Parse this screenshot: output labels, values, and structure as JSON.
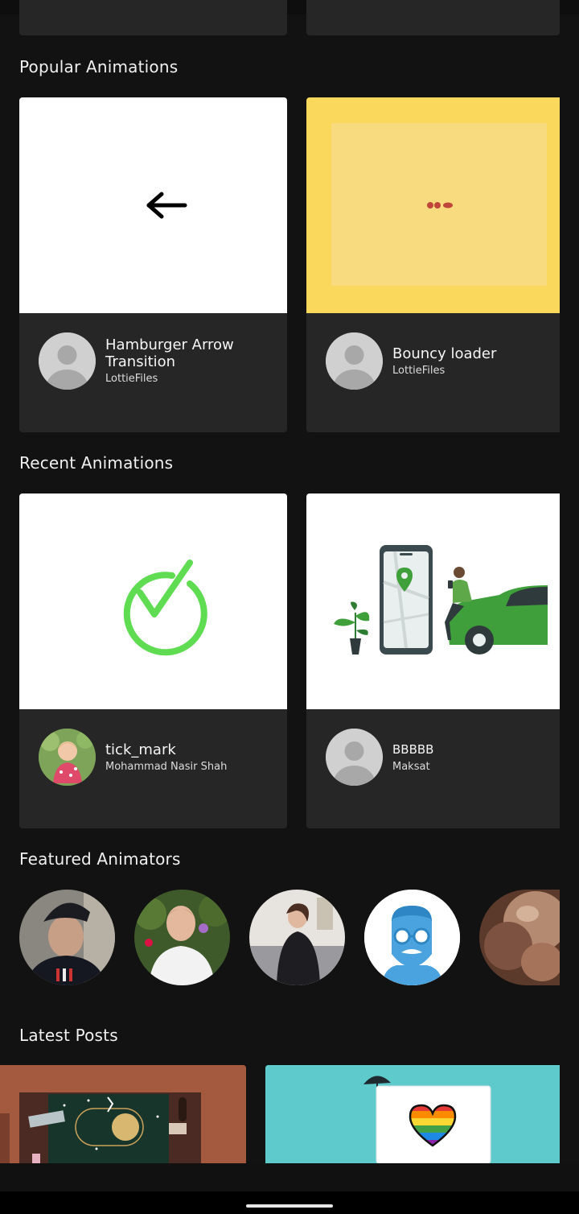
{
  "sections": {
    "popular_title": "Popular Animations",
    "recent_title": "Recent Animations",
    "featured_title": "Featured Animators",
    "posts_title": "Latest Posts"
  },
  "popular": [
    {
      "title": "Hamburger Arrow Transition",
      "author": "LottieFiles"
    },
    {
      "title": "Bouncy loader",
      "author": "LottieFiles"
    }
  ],
  "recent": [
    {
      "title": "tick_mark",
      "author": "Mohammad Nasir Shah"
    },
    {
      "title": "BBBBB",
      "author": "Maksat"
    }
  ],
  "featured_animators": [
    {
      "icon": "animator-avatar-cap"
    },
    {
      "icon": "animator-avatar-smiling"
    },
    {
      "icon": "animator-avatar-woman"
    },
    {
      "icon": "animator-avatar-beard-illustration"
    },
    {
      "icon": "animator-avatar-blurry"
    }
  ],
  "colors": {
    "background": "#121212",
    "card": "#262626",
    "yellow_preview": "#f9d85b",
    "tick_green": "#5fdc52",
    "post_teal": "#5ecacc",
    "post_brown": "#a45a3e"
  }
}
